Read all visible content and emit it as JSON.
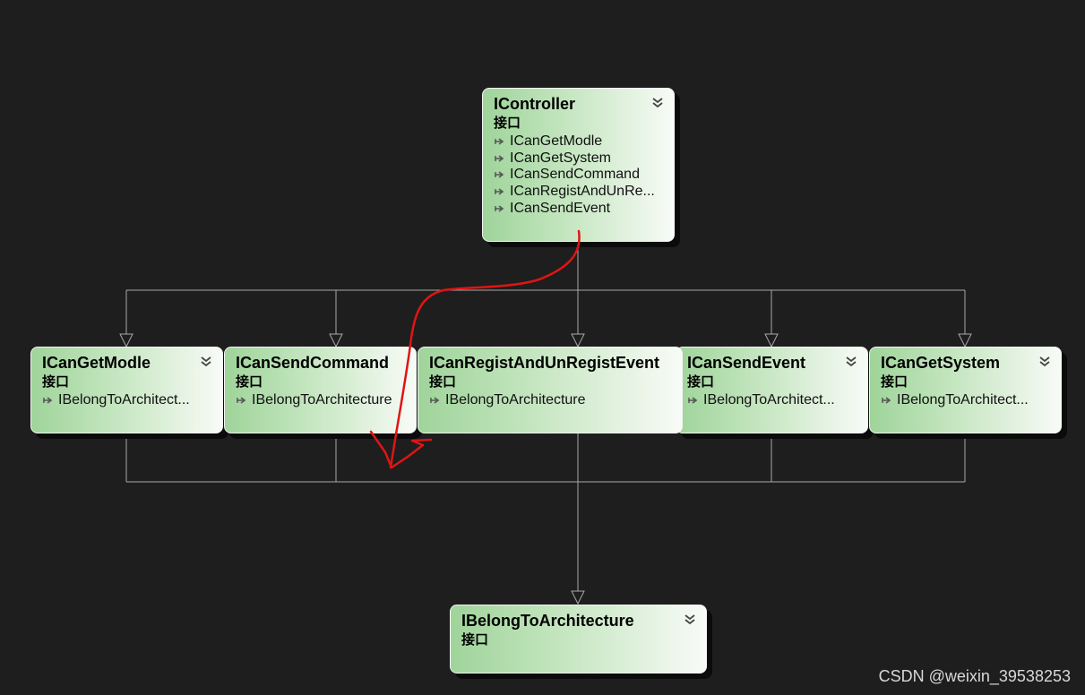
{
  "colors": {
    "background": "#1e1e1e",
    "connector": "#a8a8a8",
    "node_gradient_start": "#9fd49a",
    "node_gradient_end": "#f8fbf7",
    "annotation": "#e01414"
  },
  "icons": {
    "collapse": "double-chevron-down-icon",
    "member": "interface-implementation-arrow-icon"
  },
  "nodes": {
    "icontroller": {
      "title": "IController",
      "kind": "接口",
      "members": [
        "ICanGetModle",
        "ICanGetSystem",
        "ICanSendCommand",
        "ICanRegistAndUnRe...",
        "ICanSendEvent"
      ]
    },
    "icangetmodle": {
      "title": "ICanGetModle",
      "kind": "接口",
      "members": [
        "IBelongToArchitect..."
      ]
    },
    "icansendcommand": {
      "title": "ICanSendCommand",
      "kind": "接口",
      "members": [
        "IBelongToArchitecture"
      ]
    },
    "icanregistandunregistevent": {
      "title": "ICanRegistAndUnRegistEvent",
      "kind": "接口",
      "members": [
        "IBelongToArchitecture"
      ]
    },
    "icansendevent": {
      "title": "ICanSendEvent",
      "kind": "接口",
      "members": [
        "IBelongToArchitect..."
      ]
    },
    "icangetsystem": {
      "title": "ICanGetSystem",
      "kind": "接口",
      "members": [
        "IBelongToArchitect..."
      ]
    },
    "ibelongtoarchitecture": {
      "title": "IBelongToArchitecture",
      "kind": "接口",
      "members": []
    }
  },
  "watermark": "CSDN @weixin_39538253"
}
